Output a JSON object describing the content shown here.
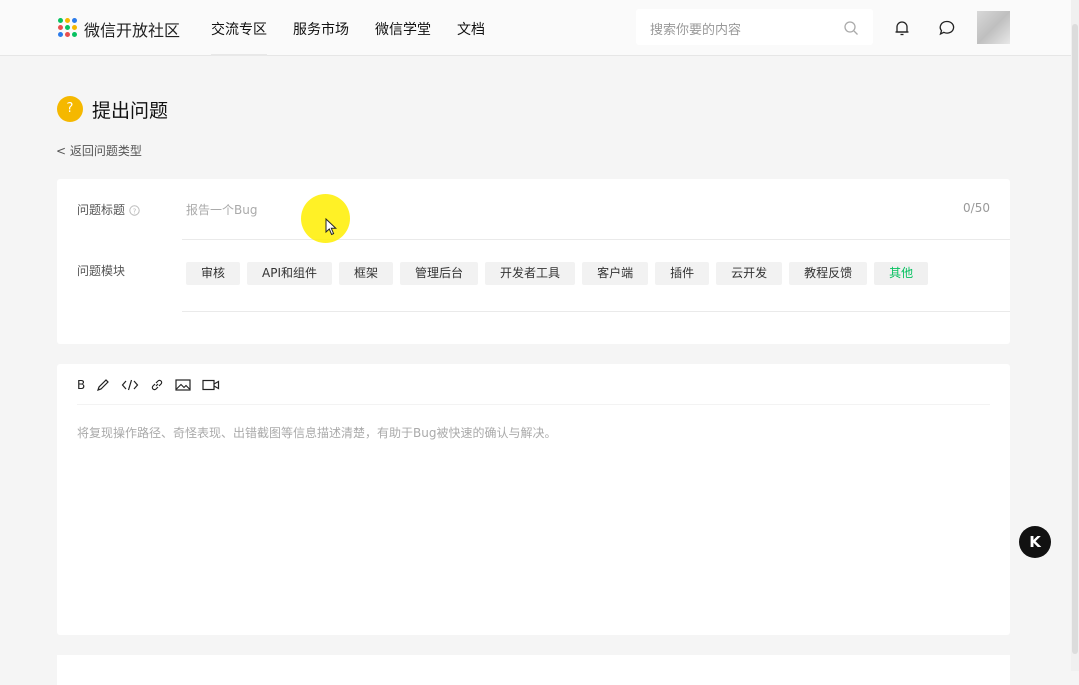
{
  "header": {
    "brand": "微信开放社区",
    "nav": [
      "交流专区",
      "服务市场",
      "微信学堂",
      "文档"
    ],
    "search_placeholder": "搜索你要的内容",
    "icons": [
      "search-icon",
      "bell-icon",
      "chat-icon"
    ]
  },
  "page": {
    "badge": "?",
    "title": "提出问题",
    "back_link": "< 返回问题类型"
  },
  "form": {
    "title_label": "问题标题",
    "title_placeholder": "报告一个Bug",
    "title_counter": "0/50",
    "module_label": "问题模块",
    "modules": [
      "审核",
      "API和组件",
      "框架",
      "管理后台",
      "开发者工具",
      "客户端",
      "插件",
      "云开发",
      "教程反馈",
      "其他"
    ],
    "active_module": "其他"
  },
  "editor": {
    "toolbar": [
      "bold",
      "pen-icon",
      "code-icon",
      "link-icon",
      "image-icon",
      "video-icon"
    ],
    "bold_label": "B",
    "placeholder": "将复现操作路径、奇怪表现、出错截图等信息描述清楚，有助于Bug被快速的确认与解决。"
  },
  "floating_button": "K",
  "colors": {
    "accent": "#07c160",
    "badge": "#f5b800",
    "cursor_highlight": "#ffee00"
  }
}
